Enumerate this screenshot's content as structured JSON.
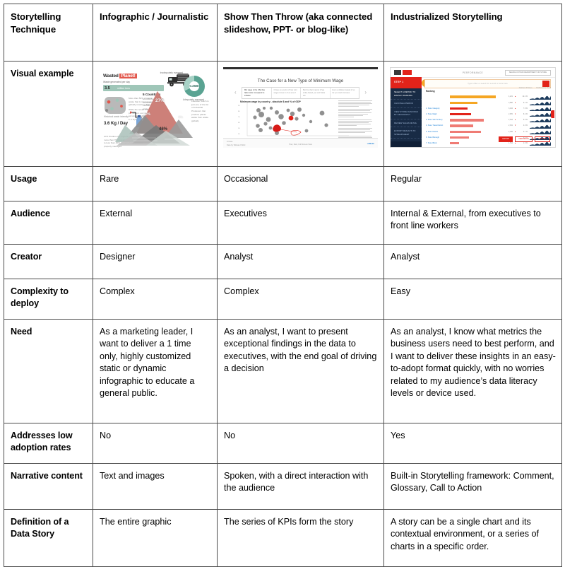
{
  "table": {
    "columns": [
      "Storytelling Technique",
      "Infographic / Journalistic",
      "Show Then Throw (aka connected slideshow, PPT- or blog-like)",
      "Industrialized Storytelling"
    ],
    "rows": [
      {
        "label": "Visual example",
        "type": "visual",
        "cells": [
          "",
          "",
          ""
        ]
      },
      {
        "label": "Usage",
        "type": "text",
        "cells": [
          "Rare",
          "Occasional",
          "Regular"
        ]
      },
      {
        "label": "Audience",
        "type": "text",
        "cells": [
          "External",
          "Executives",
          "Internal & External, from executives to front line workers"
        ]
      },
      {
        "label": "Creator",
        "type": "text",
        "cells": [
          "Designer",
          "Analyst",
          "Analyst"
        ]
      },
      {
        "label": "Complexity to deploy",
        "type": "text",
        "cells": [
          "Complex",
          "Complex",
          "Easy"
        ]
      },
      {
        "label": "Need",
        "type": "text",
        "cells": [
          "As a marketing leader, I want to deliver a 1 time only, highly customized static or dynamic infographic to educate a general public.",
          "As an analyst, I want to present exceptional findings in the data to executives, with the end goal of driving a decision",
          "As an analyst, I know what metrics the business users need to best perform, and I want to deliver these insights in an easy-to-adopt format quickly, with no worries related to my audience’s data literacy levels or device used."
        ]
      },
      {
        "label": "Addresses low adoption rates",
        "type": "text",
        "cells": [
          "No",
          "No",
          "Yes"
        ]
      },
      {
        "label": "Narrative content",
        "type": "text",
        "cells": [
          "Text and images",
          "Spoken, with a direct interaction with the audience",
          "Built-in Storytelling framework: Comment, Glossary, Call to Action"
        ]
      },
      {
        "label": "Definition of a Data Story",
        "type": "text",
        "cells": [
          "The entire graphic",
          "The series of KPIs form the story",
          "A story can be a single chart and its contextual environment, or a series of charts in a specific order."
        ]
      }
    ]
  },
  "thumbnails": {
    "infographic": {
      "name": "wasted-planet-infographic",
      "title_plain": "Wasted ",
      "title_highlight": "Planet!",
      "subtitle": "Waste generated per day",
      "headline_value": "3.5",
      "headline_unit": "million tons",
      "donut_center": "0.25Bt",
      "donut_label_top": "Inadequately managed",
      "donut_label_bottom": "Adequately managed",
      "secondary_label": "Historical waste intensity",
      "secondary_value": "3.6 Kg / Day",
      "countries_label": "5 Countries",
      "countries_note": "are listed as the top 5 countries that mismanage plastic waste",
      "mountain_percents": [
        "27%",
        "10%",
        "6%",
        "46%"
      ],
      "note_mid": "More than 50% of plastic waste that is mismanaged globally results in 80%",
      "note_left": "While the ocean only 20 tons per annum, our oceans accumulate with plastic results in 1.8 percent",
      "note_right": "Likewise, which is just one of the list of Industrial Producers that produce plastic waste from waste globally",
      "note_bottom": "All 5 Produce the highest plastic waste, more than 70% capabilities, and with less to less than 46% are generated waste is properly managed",
      "colors": {
        "accent_red": "#e2574c",
        "accent_teal": "#9fc6b8",
        "mountain_gray": "#b6b6b6"
      }
    },
    "slideshow": {
      "name": "minimum-wage-article",
      "title": "The Case for a New Type of Minimum Wage",
      "steps": [
        "Min wage in the USA has fallen when compared to inflation",
        "Chose an era for of how mini wage comes in of an era of",
        "But the chart cannot it has strike-based, per and State are",
        "Even a dollars instead of so far you work increase"
      ],
      "chart_title": "Minimum wage by country - absolute $ and % of GDP",
      "axis_x_label": "Share of GDP",
      "highlighted_labels": [
        "United States $7.25",
        "United States $15.00"
      ],
      "footer_left": "A Case",
      "footer_center": "Prev, Next, Full Screen View",
      "footer_note": "Data by Tableau Public",
      "badge": "+ableau"
    },
    "dashboard": {
      "name": "industrialized-dashboard",
      "top_title": "PERFORMANCE",
      "top_button": "SEARCH WITHIN DEPARTMENT OR STORE",
      "sidebar_header": "STEP 1",
      "search_placeholder": "Type a filter or search for a word or store here",
      "ranking_label": "Ranking",
      "nav_items": [
        "SELECT A METRIC TO DISPLAY RANKING",
        "CHOOSE A PERIOD",
        "VIEW STORE RANKINGS BY GEOGRAPHY",
        "REVIEW SALES DETAIL",
        "EXPORT RESULTS TO SPREADSHEET"
      ],
      "col_headers": [
        "Number of Stores",
        "Performance Trend"
      ],
      "bars": [
        {
          "label": "",
          "pct": 86,
          "color": "#f5a623",
          "value": "4,221",
          "delta": "▲",
          "delta_color": "#e2231a",
          "change": "12.4 %"
        },
        {
          "label": "",
          "pct": 52,
          "color": "#f5a623",
          "value": "3,890",
          "delta": "▼",
          "delta_color": "#e2231a",
          "change": "9.1 %"
        },
        {
          "label": "1. Store Category",
          "pct": 33,
          "color": "#e2231a",
          "value": "3,102",
          "delta": "▲",
          "delta_color": "#e2231a",
          "change": "7.8 %"
        },
        {
          "label": "2. Store Major",
          "pct": 40,
          "color": "#e2231a",
          "value": "2,870",
          "delta": "▼",
          "delta_color": "#e2231a",
          "change": "6.2 %"
        },
        {
          "label": "3. Store Sub Territory",
          "pct": 64,
          "color": "#ef7b74",
          "value": "2,644",
          "delta": "▲",
          "delta_color": "#e2231a",
          "change": "5.5 %"
        },
        {
          "label": "4. Store Trade District",
          "pct": 44,
          "color": "#ef7b74",
          "value": "2,301",
          "delta": "▼",
          "delta_color": "#e2231a",
          "change": "4.9 %"
        },
        {
          "label": "5. Store District",
          "pct": 58,
          "color": "#ef7b74",
          "value": "2,045",
          "delta": "▲",
          "delta_color": "#e2231a",
          "change": "3.7 %"
        },
        {
          "label": "6. Store Borough",
          "pct": 36,
          "color": "#ef7b74",
          "value": "1,880",
          "delta": "▼",
          "delta_color": "#e2231a",
          "change": "2.8 %"
        },
        {
          "label": "7. Store Block",
          "pct": 17,
          "color": "#ef7b74",
          "value": "1,512",
          "delta": "▲",
          "delta_color": "#e2231a",
          "change": "1.6 %"
        },
        {
          "label": "8. Store Cluster Number",
          "pct": 8,
          "color": "#f3b1ac",
          "value": "1,104",
          "delta": "▼",
          "delta_color": "#e2231a",
          "change": "0.9 %"
        }
      ],
      "footer_buttons": [
        "EXPORT",
        "VIEW DETAIL",
        "COMPARE"
      ],
      "colors": {
        "brand_red": "#e2231a",
        "sidebar_navy": "#182b45",
        "highlight_orange": "#f5a623"
      }
    }
  }
}
